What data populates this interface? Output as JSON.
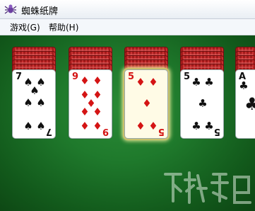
{
  "window": {
    "title": "蜘蛛纸牌",
    "icon": "spider-solitaire-app-icon"
  },
  "menu": {
    "items": [
      {
        "label": "游戏(G)"
      },
      {
        "label": "帮助(H)"
      }
    ]
  },
  "colors": {
    "felt": "#1f7a2c",
    "card_back": "#b32222",
    "red_suit": "#d41414",
    "black_suit": "#111111",
    "highlight": "#f3ef9d"
  },
  "piles": [
    {
      "face_up": {
        "rank": "7",
        "suit": "spade",
        "symbol": "♠",
        "color": "black"
      },
      "selected": false
    },
    {
      "face_up": {
        "rank": "9",
        "suit": "diamond",
        "symbol": "♦",
        "color": "red"
      },
      "selected": false
    },
    {
      "face_up": {
        "rank": "5",
        "suit": "diamond",
        "symbol": "♦",
        "color": "red"
      },
      "selected": true
    },
    {
      "face_up": {
        "rank": "5",
        "suit": "club",
        "symbol": "♣",
        "color": "black"
      },
      "selected": false
    },
    {
      "face_up": {
        "rank": "A",
        "suit": "club",
        "symbol": "♣",
        "color": "black"
      },
      "selected": false
    }
  ]
}
